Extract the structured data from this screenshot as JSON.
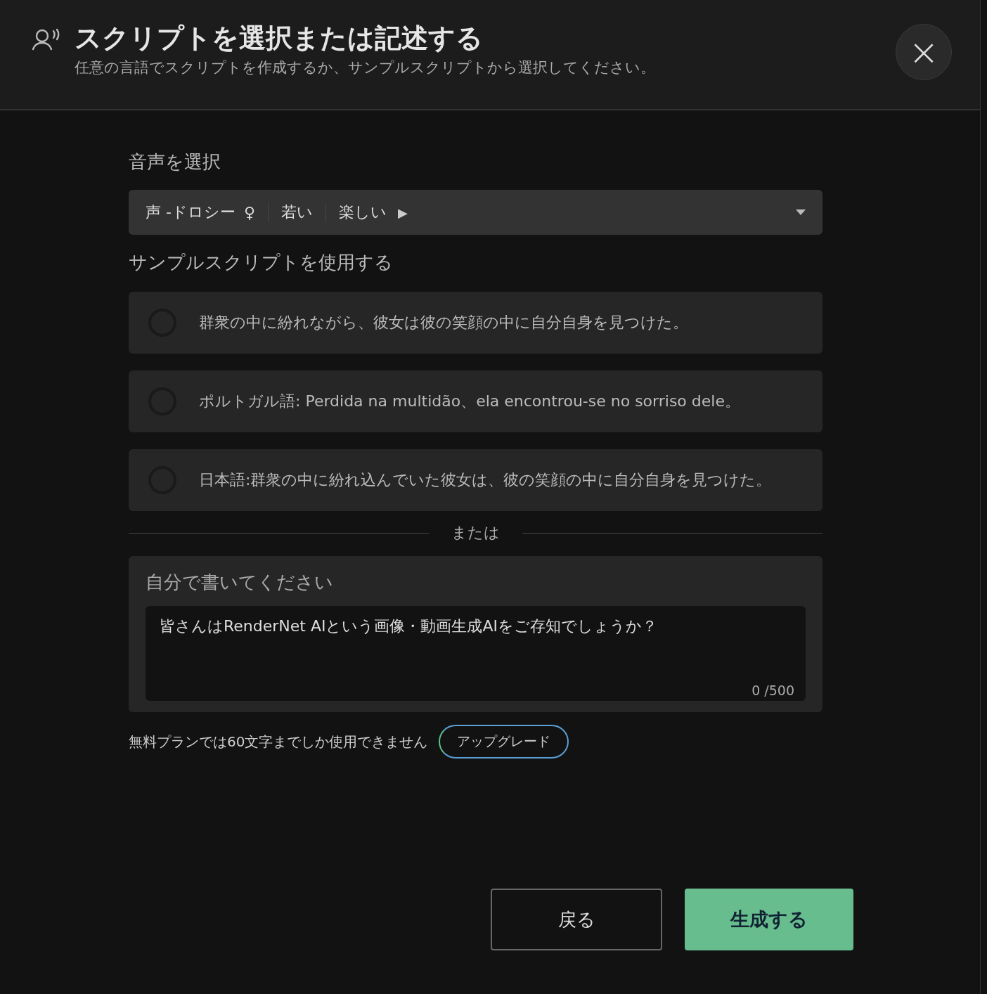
{
  "header": {
    "title": "スクリプトを選択または記述する",
    "subtitle": "任意の言語でスクリプトを作成するか、サンプルスクリプトから選択してください。",
    "close": "×"
  },
  "voice": {
    "label": "音声を選択",
    "name": "声 -ドロシー",
    "gender": "♀",
    "tags": [
      "若い",
      "楽しい"
    ],
    "play": "▶"
  },
  "samples": {
    "label": "サンプルスクリプトを使用する",
    "options": [
      {
        "text": "群衆の中に紛れながら、彼女は彼の笑顔の中に自分自身を見つけた。",
        "selected": false
      },
      {
        "text": "ポルトガル語: Perdida na multidão、ela encontrou-se no sorriso dele。",
        "selected": false
      },
      {
        "text": "日本語:群衆の中に紛れ込んでいた彼女は、彼の笑顔の中に自分自身を見つけた。",
        "selected": false
      }
    ]
  },
  "divider": "または",
  "write": {
    "label": "自分で書いてください",
    "placeholder": "皆さんはRenderNet AIという画像・動画生成AIをご存知でしょうか？",
    "counter": "0 /500"
  },
  "limit": {
    "text": "無料プランでは60文字までしか使用できません",
    "upgrade": "アップグレード"
  },
  "buttons": {
    "back": "戻る",
    "generate": "生成する"
  }
}
